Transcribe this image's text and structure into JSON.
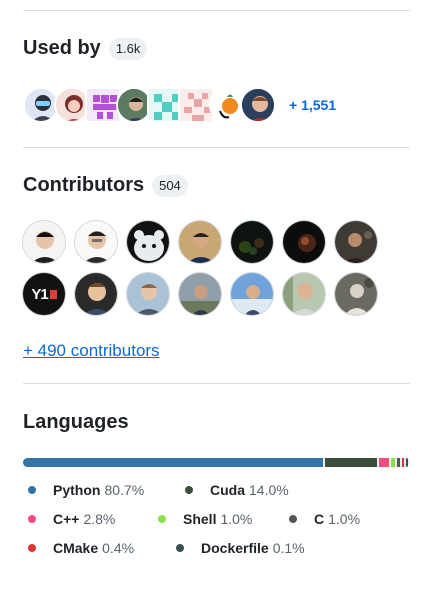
{
  "used_by": {
    "title": "Used by",
    "count": "1.6k",
    "more": "+ 1,551"
  },
  "contributors": {
    "title": "Contributors",
    "count": "504",
    "more": "+ 490 contributors",
    "avatar_text": {
      "y1": "Y1"
    }
  },
  "languages": {
    "title": "Languages",
    "items": [
      {
        "name": "Python",
        "percent": "80.7%",
        "value": 80.7,
        "color": "#3572A5"
      },
      {
        "name": "Cuda",
        "percent": "14.0%",
        "value": 14.0,
        "color": "#3A4E3A"
      },
      {
        "name": "C++",
        "percent": "2.8%",
        "value": 2.8,
        "color": "#f34b7d"
      },
      {
        "name": "Shell",
        "percent": "1.0%",
        "value": 1.0,
        "color": "#89e051"
      },
      {
        "name": "C",
        "percent": "1.0%",
        "value": 1.0,
        "color": "#555555"
      },
      {
        "name": "CMake",
        "percent": "0.4%",
        "value": 0.4,
        "color": "#DA3434"
      },
      {
        "name": "Dockerfile",
        "percent": "0.1%",
        "value": 0.1,
        "color": "#384d54"
      }
    ]
  }
}
